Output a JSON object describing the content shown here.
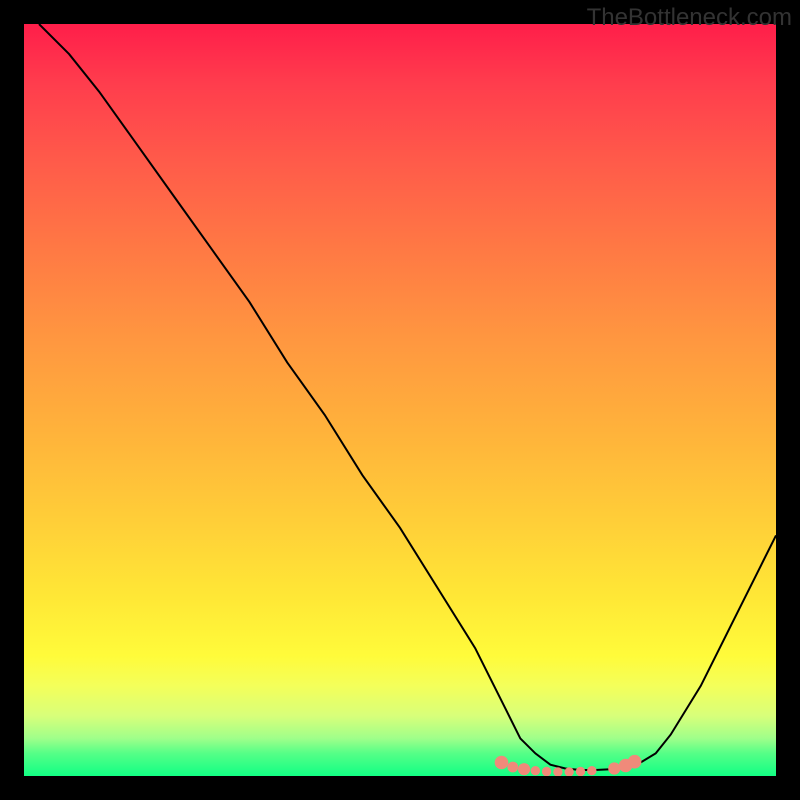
{
  "watermark": "TheBottleneck.com",
  "chart_data": {
    "type": "line",
    "title": "",
    "xlabel": "",
    "ylabel": "",
    "x_range": [
      0,
      100
    ],
    "y_range": [
      0,
      100
    ],
    "grid": false,
    "annotations": [],
    "series": [
      {
        "name": "curve",
        "color": "#000000",
        "x": [
          2,
          6,
          10,
          15,
          20,
          25,
          30,
          35,
          40,
          45,
          50,
          55,
          60,
          62,
          64,
          66,
          68,
          70,
          72,
          74,
          76,
          78,
          80,
          82,
          84,
          86,
          90,
          94,
          98,
          100
        ],
        "y": [
          100,
          96,
          91,
          84,
          77,
          70,
          63,
          55,
          48,
          40,
          33,
          25,
          17,
          13,
          9,
          5,
          3,
          1.5,
          1.0,
          0.8,
          0.8,
          0.9,
          1.2,
          1.8,
          3.0,
          5.5,
          12,
          20,
          28,
          32
        ]
      }
    ],
    "markers": [
      {
        "x": 63.5,
        "y": 1.8,
        "r": 1.0,
        "color": "#f08a7a"
      },
      {
        "x": 65.0,
        "y": 1.2,
        "r": 0.8,
        "color": "#f08a7a"
      },
      {
        "x": 66.5,
        "y": 0.9,
        "r": 0.9,
        "color": "#f08a7a"
      },
      {
        "x": 68.0,
        "y": 0.7,
        "r": 0.7,
        "color": "#f08a7a"
      },
      {
        "x": 69.5,
        "y": 0.6,
        "r": 0.7,
        "color": "#f08a7a"
      },
      {
        "x": 71.0,
        "y": 0.55,
        "r": 0.7,
        "color": "#f08a7a"
      },
      {
        "x": 72.5,
        "y": 0.55,
        "r": 0.7,
        "color": "#f08a7a"
      },
      {
        "x": 74.0,
        "y": 0.6,
        "r": 0.7,
        "color": "#f08a7a"
      },
      {
        "x": 75.5,
        "y": 0.7,
        "r": 0.7,
        "color": "#f08a7a"
      },
      {
        "x": 78.5,
        "y": 1.0,
        "r": 0.9,
        "color": "#f08a7a"
      },
      {
        "x": 80.0,
        "y": 1.4,
        "r": 1.0,
        "color": "#f08a7a"
      },
      {
        "x": 81.2,
        "y": 1.9,
        "r": 1.0,
        "color": "#f08a7a"
      }
    ]
  }
}
